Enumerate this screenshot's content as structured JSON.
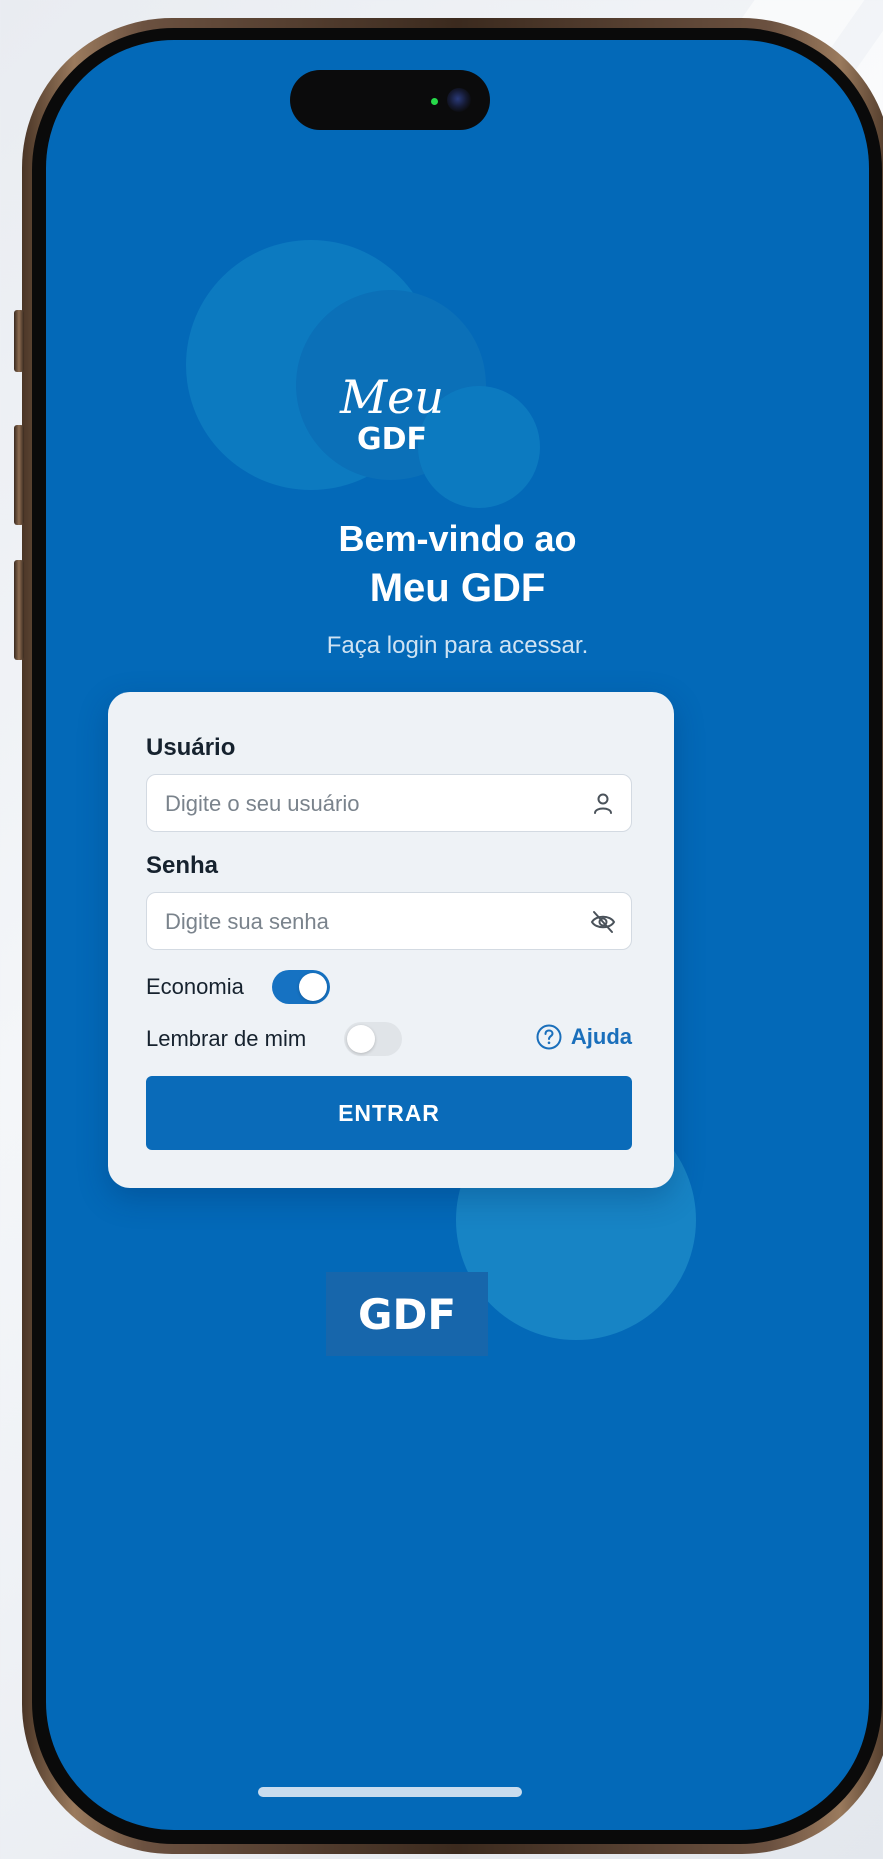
{
  "logo": {
    "script": "Meu",
    "acronym": "GDF"
  },
  "welcome": {
    "line1": "Bem-vindo ao",
    "line2": "Meu GDF",
    "subtitle": "Faça login para acessar."
  },
  "form": {
    "user_label": "Usuário",
    "user_placeholder": "Digite o seu usuário",
    "user_icon": "user-icon",
    "password_label": "Senha",
    "password_placeholder": "Digite sua senha",
    "password_icon": "eye-off-icon",
    "economia_label": "Economia",
    "economia_on": true,
    "remember_label": "Lembrar de mim",
    "remember_on": false,
    "help_label": "Ajuda",
    "help_icon": "help-circle-icon",
    "submit_label": "ENTRAR"
  },
  "footer": {
    "logo_text": "GDF"
  },
  "colors": {
    "background": "#0369b8",
    "card": "#eef2f6",
    "accent": "#0a6bb9",
    "link": "#1a6fbb"
  }
}
